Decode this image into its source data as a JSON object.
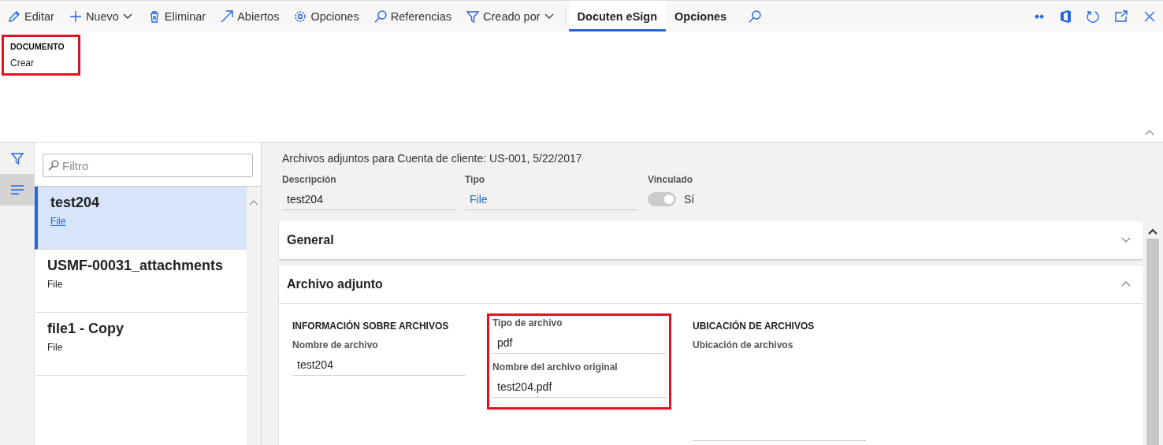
{
  "toolbar": {
    "actions": [
      {
        "label": "Editar",
        "kind": "edit",
        "dropdown": false
      },
      {
        "label": "Nuevo",
        "kind": "new",
        "dropdown": true
      },
      {
        "label": "Eliminar",
        "kind": "delete",
        "dropdown": false
      },
      {
        "label": "Abiertos",
        "kind": "open",
        "dropdown": false
      },
      {
        "label": "Opciones",
        "kind": "options",
        "dropdown": false
      },
      {
        "label": "Referencias",
        "kind": "search",
        "dropdown": false
      },
      {
        "label": "Creado por",
        "kind": "filter",
        "dropdown": true
      }
    ],
    "tabs": [
      {
        "label": "Docuten eSign",
        "selected": true
      },
      {
        "label": "Opciones",
        "selected": false
      }
    ]
  },
  "ribbon": {
    "group_title": "DOCUMENTO",
    "buttons": [
      "Crear"
    ],
    "highlighted": true
  },
  "side_strip": [
    {
      "kind": "filter",
      "selected": false
    },
    {
      "kind": "list",
      "selected": true
    }
  ],
  "list": {
    "filter_placeholder": "Filtro",
    "items": [
      {
        "title": "test204",
        "subtitle": "File",
        "selected": true
      },
      {
        "title": "USMF-00031_attachments",
        "subtitle": "File",
        "selected": false
      },
      {
        "title": "file1 - Copy",
        "subtitle": "File",
        "selected": false
      }
    ]
  },
  "detail": {
    "title": "Archivos adjuntos para Cuenta de cliente: US-001, 5/22/2017",
    "fields": [
      {
        "label": "Descripción",
        "kind": "text",
        "value": "test204"
      },
      {
        "label": "Tipo",
        "kind": "link",
        "value": "File"
      },
      {
        "label": "Vinculado",
        "kind": "toggle",
        "on": true,
        "value": "Sí"
      }
    ],
    "sections": [
      {
        "title": "General",
        "expanded": false
      },
      {
        "title": "Archivo adjunto",
        "expanded": true,
        "groups": [
          {
            "title": "INFORMACIÓN SOBRE ARCHIVOS",
            "highlighted": false,
            "fields": [
              {
                "label": "Nombre de archivo",
                "kind": "text",
                "value": "test204"
              }
            ]
          },
          {
            "highlighted": true,
            "fields": [
              {
                "label": "Tipo de archivo",
                "kind": "text",
                "value": "pdf"
              },
              {
                "label": "Nombre del archivo original",
                "kind": "text",
                "value": "test204.pdf"
              }
            ]
          },
          {
            "title": "UBICACIÓN DE ARCHIVOS",
            "highlighted": false,
            "fields": [
              {
                "label": "Ubicación de archivos",
                "kind": "multiline"
              }
            ]
          }
        ]
      }
    ]
  }
}
